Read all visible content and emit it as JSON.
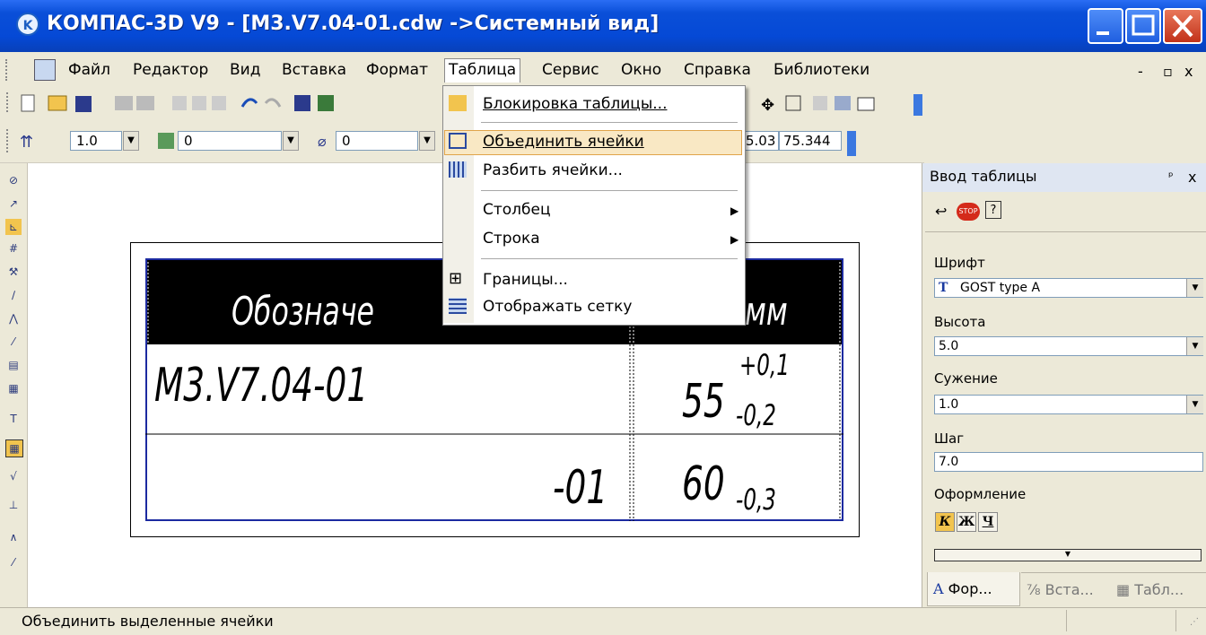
{
  "window": {
    "title": "КОМПАС-3D V9 - [M3.V7.04-01.cdw ->Системный вид]",
    "app_icon": "kompas-logo-icon"
  },
  "menubar": {
    "items": [
      {
        "label": "Файл"
      },
      {
        "label": "Редактор"
      },
      {
        "label": "Вид"
      },
      {
        "label": "Вставка"
      },
      {
        "label": "Формат"
      },
      {
        "label": "Таблица"
      },
      {
        "label": "Сервис"
      },
      {
        "label": "Окно"
      },
      {
        "label": "Справка"
      },
      {
        "label": "Библиотеки"
      }
    ],
    "doc_controls": [
      "-",
      "▫",
      "x"
    ]
  },
  "toolbar2": {
    "style_value": "1.0",
    "layer_value": "0",
    "hatch_value": "0",
    "coord_x": "5.03",
    "coord_y": "75.344"
  },
  "dropdown": {
    "items": [
      {
        "label": "Блокировка таблицы...",
        "icon": "table-lock-icon"
      },
      {
        "label": "Объединить ячейки",
        "icon": "merge-cells-icon",
        "highlighted": true
      },
      {
        "label": "Разбить ячейки...",
        "icon": "split-cells-icon"
      },
      {
        "label": "Столбец",
        "submenu": true
      },
      {
        "label": "Строка",
        "submenu": true
      },
      {
        "label": "Границы...",
        "icon": "borders-icon"
      },
      {
        "label": "Отображать сетку",
        "icon": "show-grid-icon"
      }
    ]
  },
  "drawing": {
    "header_col1": "Обозначе",
    "header_col2": "мм",
    "row1_col1": "M3.V7.04-01",
    "row1_col2_base": "55",
    "row1_col2_upper": "+0,1",
    "row1_col2_lower": "-0,2",
    "row2_col1": "-01",
    "row2_col2_base": "60",
    "row2_col2_lower": "-0,3"
  },
  "panel": {
    "title": "Ввод таблицы",
    "pin": "ᵖ",
    "close": "x",
    "font_label": "Шрифт",
    "font_value": "GOST type A",
    "height_label": "Высота",
    "height_value": "5.0",
    "narrow_label": "Сужение",
    "narrow_value": "1.0",
    "step_label": "Шаг",
    "step_value": "7.0",
    "style_label": "Оформление",
    "style_buttons": [
      "К",
      "Ж",
      "Ч"
    ],
    "tabs": [
      {
        "label": "Фор...",
        "icon": "A"
      },
      {
        "label": "Вста...",
        "icon": "⅞"
      },
      {
        "label": "Табл...",
        "icon": "▦"
      }
    ]
  },
  "statusbar": {
    "text": "Объединить выделенные ячейки"
  },
  "colors": {
    "titlebar": "#0549d6",
    "menu_highlight": "#f9e8c4",
    "table_border": "#1c2aa0"
  }
}
